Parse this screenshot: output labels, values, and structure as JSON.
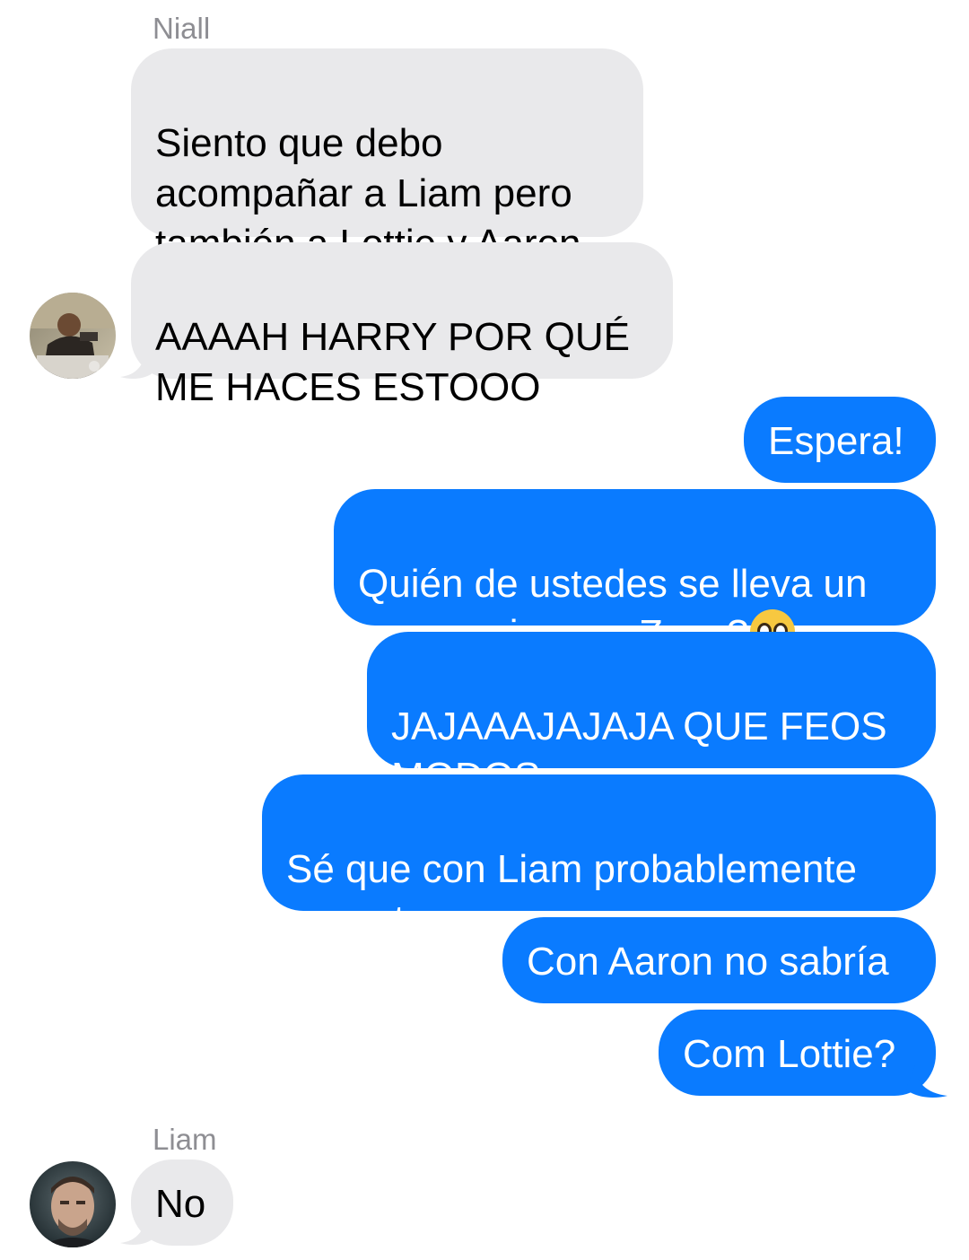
{
  "conversation": {
    "group_1": {
      "sender": "Niall",
      "messages": [
        "Siento que debo\nacompañar a Liam pero\ntambién a Lottie y Aaron",
        "AAAAH HARRY POR QUÉ\nME HACES ESTOOO"
      ],
      "avatar": "niall-avatar"
    },
    "outgoing": {
      "messages": [
        "Espera!",
        "Quién de ustedes se lleva un\npoco mejor con Zayn?",
        "JAJAAAJAJAJA QUE FEOS\nMODOS",
        "Sé que con Liam probablemente\nse maten",
        "Con Aaron no sabría",
        "Com Lottie?"
      ],
      "emoji": "pleading-face-emoji"
    },
    "group_2": {
      "sender": "Liam",
      "messages": [
        "No"
      ],
      "avatar": "liam-avatar"
    }
  },
  "colors": {
    "incoming_bubble": "#e9e9eb",
    "outgoing_bubble": "#0a7bff",
    "sender_name": "#8e8e93"
  }
}
